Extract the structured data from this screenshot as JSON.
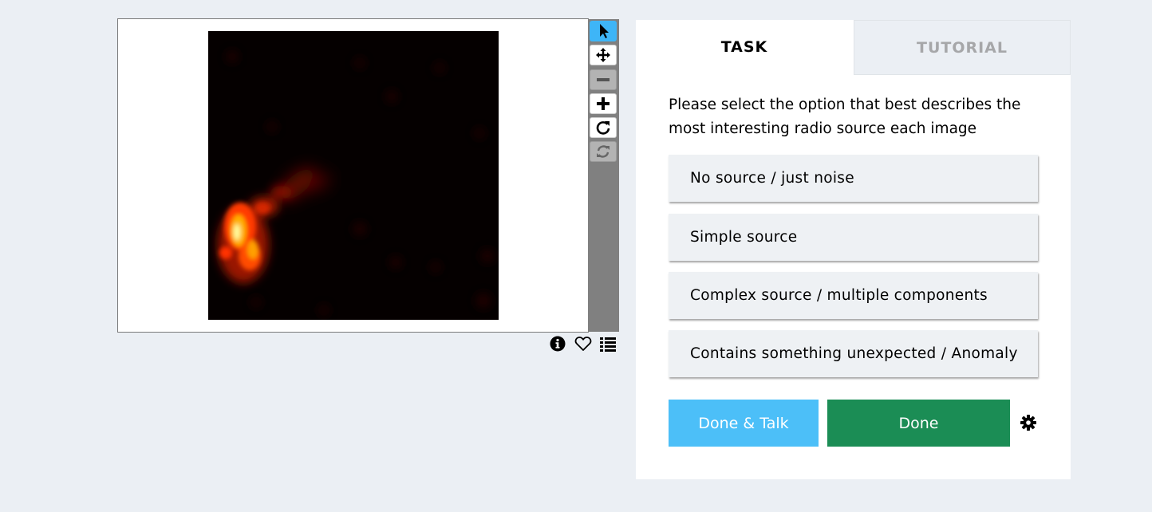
{
  "viewer": {
    "toolbar": [
      {
        "name": "pointer-tool",
        "icon": "pointer-arrow-icon",
        "state": "active"
      },
      {
        "name": "pan-tool",
        "icon": "move-arrows-icon",
        "state": "enabled"
      },
      {
        "name": "zoom-out-tool",
        "icon": "minus-icon",
        "state": "disabled"
      },
      {
        "name": "zoom-in-tool",
        "icon": "plus-icon",
        "state": "enabled"
      },
      {
        "name": "rotate-tool",
        "icon": "rotate-icon",
        "state": "enabled"
      },
      {
        "name": "reset-tool",
        "icon": "refresh-icon",
        "state": "disabled"
      }
    ],
    "meta_icons": [
      "info-icon",
      "heart-icon",
      "list-icon"
    ]
  },
  "tabs": {
    "task": "TASK",
    "tutorial": "TUTORIAL"
  },
  "task": {
    "instruction": "Please select the option that best describes the most interesting radio source each image",
    "answers": [
      "No source / just noise",
      "Simple source",
      "Complex source / multiple components",
      "Contains something unexpected / Anomaly"
    ]
  },
  "buttons": {
    "done_talk": "Done & Talk",
    "done": "Done"
  },
  "colors": {
    "background": "#ebeff4",
    "active_tool": "#3eb5f7",
    "done_talk": "#4cbff8",
    "done": "#1b8d55",
    "tab_inactive_text": "#a6a7a9"
  }
}
